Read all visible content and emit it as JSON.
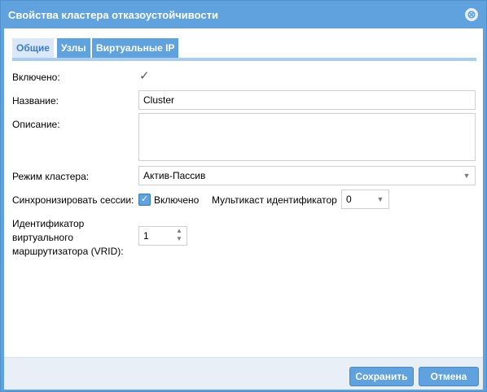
{
  "window": {
    "title": "Свойства кластера отказоустойчивости",
    "close_icon": "⊗"
  },
  "tabs": [
    {
      "label": "Общие",
      "active": true
    },
    {
      "label": "Узлы",
      "active": false
    },
    {
      "label": "Виртуальные IP",
      "active": false
    }
  ],
  "form": {
    "enabled": {
      "label": "Включено:",
      "checked": true
    },
    "name": {
      "label": "Название:",
      "value": "Cluster"
    },
    "description": {
      "label": "Описание:",
      "value": ""
    },
    "mode": {
      "label": "Режим кластера:",
      "value": "Актив-Пассив"
    },
    "sync": {
      "label": "Синхронизировать сессии:",
      "checkbox_label": "Включено",
      "checked": true
    },
    "multicast": {
      "label": "Мультикаст идентификатор",
      "value": "0"
    },
    "vrid": {
      "label_line1": "Идентификатор",
      "label_line2": "виртуального",
      "label_line3": "маршрутизатора (VRID):",
      "value": "1"
    }
  },
  "footer": {
    "save_label": "Сохранить",
    "cancel_label": "Отмена"
  },
  "colors": {
    "accent": "#5fa2dd",
    "tab_active_bg": "#d9e7f7",
    "footer_bg": "#e9eff6"
  }
}
